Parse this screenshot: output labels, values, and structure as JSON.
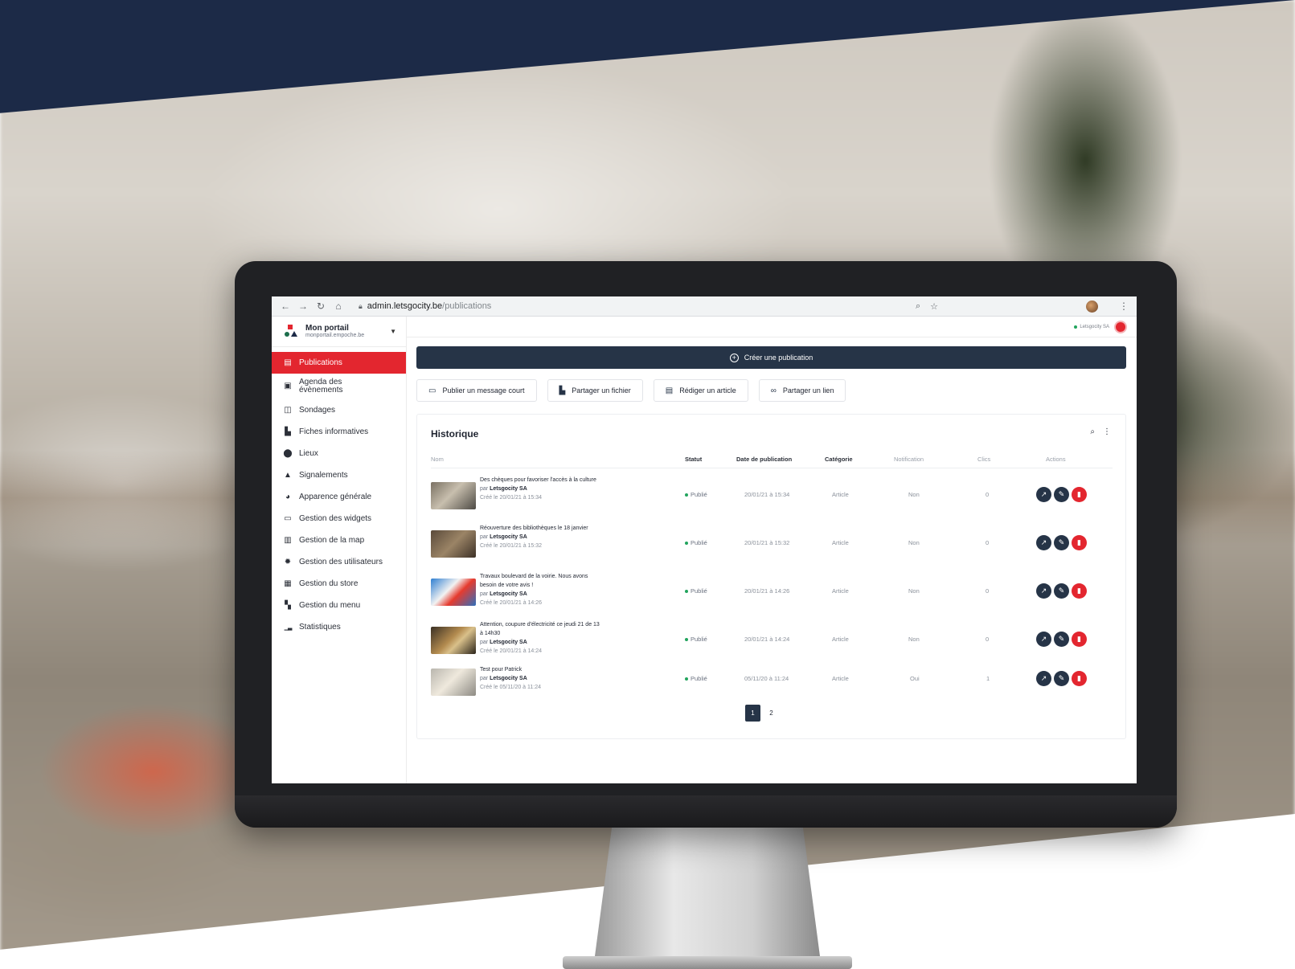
{
  "browser": {
    "url_host": "admin.letsgocity.be",
    "url_path": "/publications"
  },
  "brand": {
    "name": "Mon portail",
    "url": "monportail.empoche.be"
  },
  "topbar": {
    "org_name": "Letsgocity SA"
  },
  "sidebar": {
    "items": [
      {
        "label": "Publications",
        "icon": "message-icon",
        "glyph": "▤",
        "active": true
      },
      {
        "label": "Agenda des évènements",
        "icon": "calendar-icon",
        "glyph": "▣",
        "active": false
      },
      {
        "label": "Sondages",
        "icon": "poll-icon",
        "glyph": "◫",
        "active": false
      },
      {
        "label": "Fiches informatives",
        "icon": "document-icon",
        "glyph": "▙",
        "active": false
      },
      {
        "label": "Lieux",
        "icon": "map-pin-icon",
        "glyph": "⬤",
        "active": false
      },
      {
        "label": "Signalements",
        "icon": "warning-icon",
        "glyph": "▲",
        "active": false
      },
      {
        "label": "Apparence générale",
        "icon": "palette-icon",
        "glyph": "◕",
        "active": false
      },
      {
        "label": "Gestion des widgets",
        "icon": "widget-icon",
        "glyph": "▭",
        "active": false
      },
      {
        "label": "Gestion de la map",
        "icon": "map-icon",
        "glyph": "▥",
        "active": false
      },
      {
        "label": "Gestion des utilisateurs",
        "icon": "gear-icon",
        "glyph": "✹",
        "active": false
      },
      {
        "label": "Gestion du store",
        "icon": "store-icon",
        "glyph": "▦",
        "active": false
      },
      {
        "label": "Gestion du menu",
        "icon": "grid-icon",
        "glyph": "▚",
        "active": false
      },
      {
        "label": "Statistiques",
        "icon": "bar-chart-icon",
        "glyph": "▁▃",
        "active": false
      }
    ]
  },
  "main": {
    "create_label": "Créer une publication",
    "quick_actions": [
      {
        "label": "Publier un message court",
        "icon": "chat-icon",
        "glyph": "▭"
      },
      {
        "label": "Partager un fichier",
        "icon": "file-icon",
        "glyph": "▙"
      },
      {
        "label": "Rédiger un article",
        "icon": "article-icon",
        "glyph": "▤"
      },
      {
        "label": "Partager un lien",
        "icon": "link-icon",
        "glyph": "∞"
      }
    ],
    "history": {
      "title": "Historique",
      "columns": {
        "name": "Nom",
        "status": "Statut",
        "date": "Date de publication",
        "category": "Catégorie",
        "notification": "Notification",
        "clicks": "Clics",
        "actions": "Actions"
      },
      "rows": [
        {
          "title": "Des chèques pour favoriser l'accès à la culture",
          "by_prefix": "par",
          "author": "Letsgocity SA",
          "created": "Créé le 20/01/21 à 15:34",
          "status": "Publié",
          "date": "20/01/21 à 15:34",
          "category": "Article",
          "notification": "Non",
          "clicks": "0"
        },
        {
          "title": "Réouverture des bibliothèques le 18 janvier",
          "by_prefix": "par",
          "author": "Letsgocity SA",
          "created": "Créé le 20/01/21 à 15:32",
          "status": "Publié",
          "date": "20/01/21 à 15:32",
          "category": "Article",
          "notification": "Non",
          "clicks": "0"
        },
        {
          "title": "Travaux boulevard de la voirie. Nous avons besoin de votre avis !",
          "by_prefix": "par",
          "author": "Letsgocity SA",
          "created": "Créé le 20/01/21 à 14:26",
          "status": "Publié",
          "date": "20/01/21 à 14:26",
          "category": "Article",
          "notification": "Non",
          "clicks": "0"
        },
        {
          "title": "Attention, coupure d'électricité ce jeudi 21 de 13 à 14h30",
          "by_prefix": "par",
          "author": "Letsgocity SA",
          "created": "Créé le 20/01/21 à 14:24",
          "status": "Publié",
          "date": "20/01/21 à 14:24",
          "category": "Article",
          "notification": "Non",
          "clicks": "0"
        },
        {
          "title": "Test pour Patrick",
          "by_prefix": "par",
          "author": "Letsgocity SA",
          "created": "Créé le 05/11/20 à 11:24",
          "status": "Publié",
          "date": "05/11/20 à 11:24",
          "category": "Article",
          "notification": "Oui",
          "clicks": "1"
        }
      ],
      "pagination": [
        "1",
        "2"
      ]
    }
  },
  "colors": {
    "banner": "#1c2a47",
    "accent": "#e3262f",
    "dark_button": "#263447",
    "status_published": "#22a45d"
  }
}
